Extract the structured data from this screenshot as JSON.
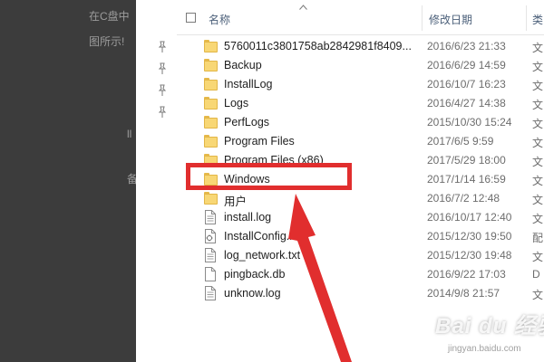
{
  "background_text": [
    "在C盘中",
    "图所示!",
    "ll",
    "备"
  ],
  "headers": {
    "name": "名称",
    "date": "修改日期",
    "type": "类"
  },
  "rows": [
    {
      "icon": "folder-icon",
      "name": "5760011c3801758ab2842981f8409...",
      "date": "2016/6/23 21:33",
      "type": "文"
    },
    {
      "icon": "folder-icon",
      "name": "Backup",
      "date": "2016/6/29 14:59",
      "type": "文"
    },
    {
      "icon": "folder-icon",
      "name": "InstallLog",
      "date": "2016/10/7 16:23",
      "type": "文"
    },
    {
      "icon": "folder-icon",
      "name": "Logs",
      "date": "2016/4/27 14:38",
      "type": "文"
    },
    {
      "icon": "folder-icon",
      "name": "PerfLogs",
      "date": "2015/10/30 15:24",
      "type": "文"
    },
    {
      "icon": "folder-icon",
      "name": "Program Files",
      "date": "2017/6/5 9:59",
      "type": "文"
    },
    {
      "icon": "folder-icon",
      "name": "Program Files (x86)",
      "date": "2017/5/29 18:00",
      "type": "文"
    },
    {
      "icon": "folder-icon",
      "name": "Windows",
      "date": "2017/1/14 16:59",
      "type": "文"
    },
    {
      "icon": "folder-icon",
      "name": "用户",
      "date": "2016/7/2 12:48",
      "type": "文"
    },
    {
      "icon": "text-file-icon",
      "name": "install.log",
      "date": "2016/10/17 12:40",
      "type": "文"
    },
    {
      "icon": "config-file-icon",
      "name": "InstallConfig.ini",
      "date": "2015/12/30 19:50",
      "type": "配"
    },
    {
      "icon": "text-file-icon",
      "name": "log_network.txt",
      "date": "2015/12/30 19:48",
      "type": "文"
    },
    {
      "icon": "file-icon",
      "name": "pingback.db",
      "date": "2016/9/22 17:03",
      "type": "D"
    },
    {
      "icon": "text-file-icon",
      "name": "unknow.log",
      "date": "2014/9/8 21:57",
      "type": "文"
    }
  ],
  "watermark": {
    "logo": "Bai du 经验",
    "url": "jingyan.baidu.com"
  },
  "colors": {
    "highlight": "#e12e2e",
    "folder": "#f8d775",
    "backdrop": "#3c3c3c"
  }
}
